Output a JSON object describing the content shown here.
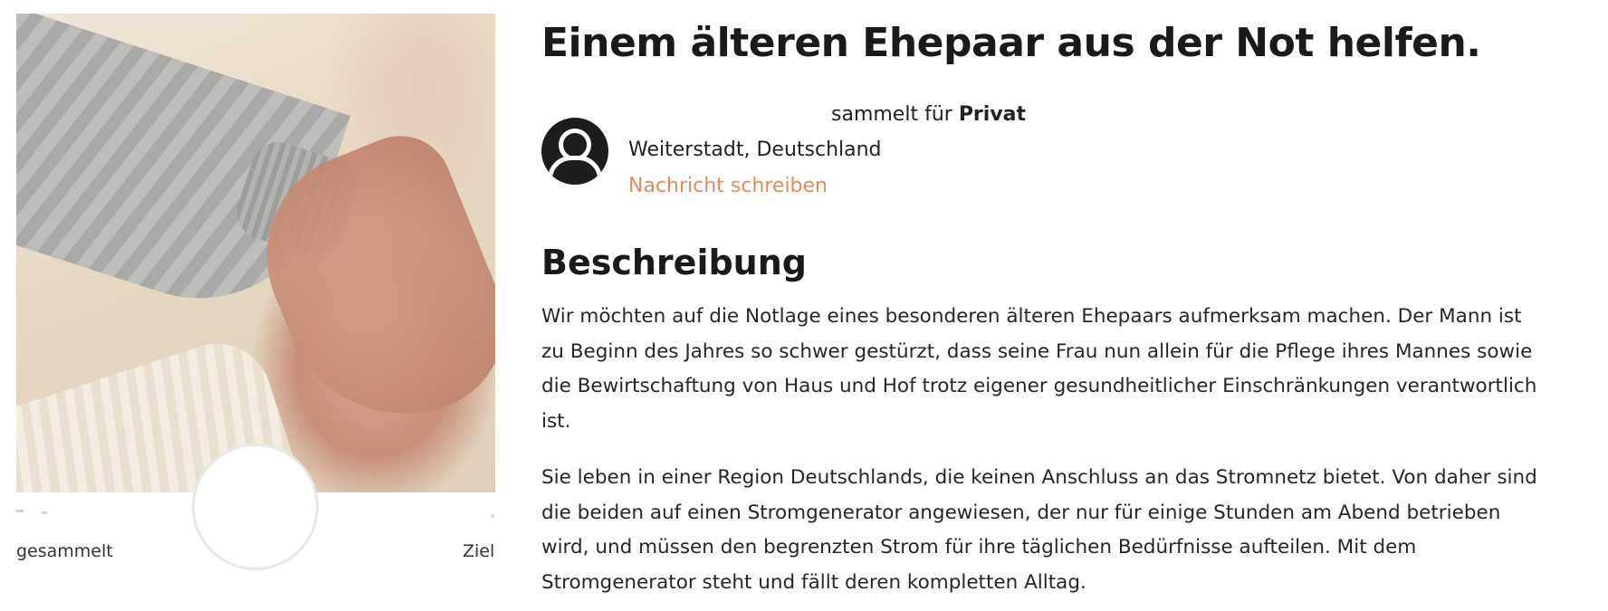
{
  "campaign": {
    "title": "Einem älteren Ehepaar aus der Not helfen.",
    "collects_prefix": "sammelt für ",
    "collects_for": "Privat",
    "location": "Weiterstadt, Deutschland",
    "message_link": "Nachricht schreiben"
  },
  "stats": {
    "collected_label": "gesammelt",
    "goal_label": "Ziel"
  },
  "description": {
    "heading": "Beschreibung",
    "paragraphs": [
      "Wir möchten auf die Notlage eines besonderen älteren Ehepaars aufmerksam machen. Der Mann ist zu Beginn des Jahres so schwer gestürzt, dass seine Frau nun allein für die Pflege ihres Mannes sowie die Bewirtschaftung von Haus und Hof trotz eigener gesundheitlicher Einschränkungen verantwortlich ist.",
      "Sie leben in einer Region Deutschlands, die keinen Anschluss an das Stromnetz bietet. Von daher sind die beiden auf einen Stromgenerator angewiesen, der nur für einige Stunden am Abend betrieben wird, und müssen den begrenzten Strom für ihre täglichen Bedürfnisse aufteilen. Mit dem Stromgenerator steht und fällt deren kompletten Alltag."
    ]
  },
  "colors": {
    "accent_link": "#e48b57",
    "text": "#1f1f1f"
  },
  "icons": {
    "avatar": "user-avatar-icon"
  }
}
